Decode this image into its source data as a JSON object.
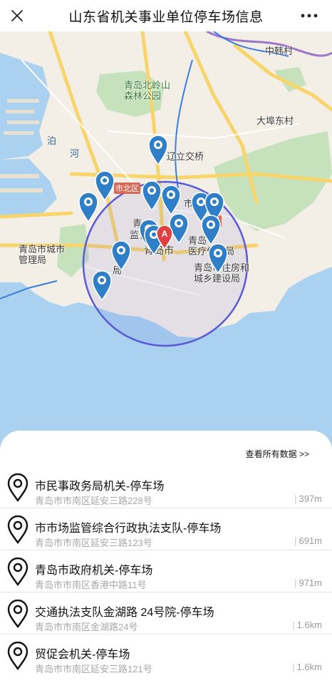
{
  "header": {
    "title": "山东省机关事业单位停车场信息"
  },
  "map": {
    "place_labels": {
      "zhonghancun": "中韩村",
      "beilingshan": "青岛北岭山\n森林公园",
      "dabudongcun": "大埠东村",
      "bo": "泊",
      "he": "河",
      "liaoning": "辽立交桥",
      "shibeiqu": "市北区",
      "shi": "市",
      "jian": "监管",
      "qingdaoshi": "青岛市",
      "chengshi": "青岛市城市\n管理局",
      "yiliao": "青岛\n医疗保障局",
      "zhujian": "青岛市住房和\n城乡建设局",
      "ju": "局",
      "qu": "区",
      "qing": "青"
    },
    "marker_center_label": "A",
    "colors": {
      "water": "#aad2f0",
      "land": "#f3efe6",
      "green": "#c6e2bc",
      "road_yellow": "#f7d56b",
      "pin_blue": "#2f7fc8",
      "circle": "#5a5ad8",
      "pin_red": "#e04040"
    }
  },
  "sheet": {
    "view_all": "查看所有数据 >>",
    "items": [
      {
        "name": "市民事政务局机关-停车场",
        "address": "青岛市市南区延安三路228号",
        "distance": "397m"
      },
      {
        "name": "市市场监管综合行政执法支队-停车场",
        "address": "青岛市市南区延安三路123号",
        "distance": "691m"
      },
      {
        "name": "青岛市政府机关-停车场",
        "address": "青岛市市南区香港中路11号",
        "distance": "971m"
      },
      {
        "name": "交通执法支队金湖路 24号院-停车场",
        "address": "青岛市市南区金湖路24号",
        "distance": "1.6km"
      },
      {
        "name": "贸促会机关-停车场",
        "address": "青岛市市南区延安三路121号",
        "distance": "1.6km"
      }
    ]
  }
}
